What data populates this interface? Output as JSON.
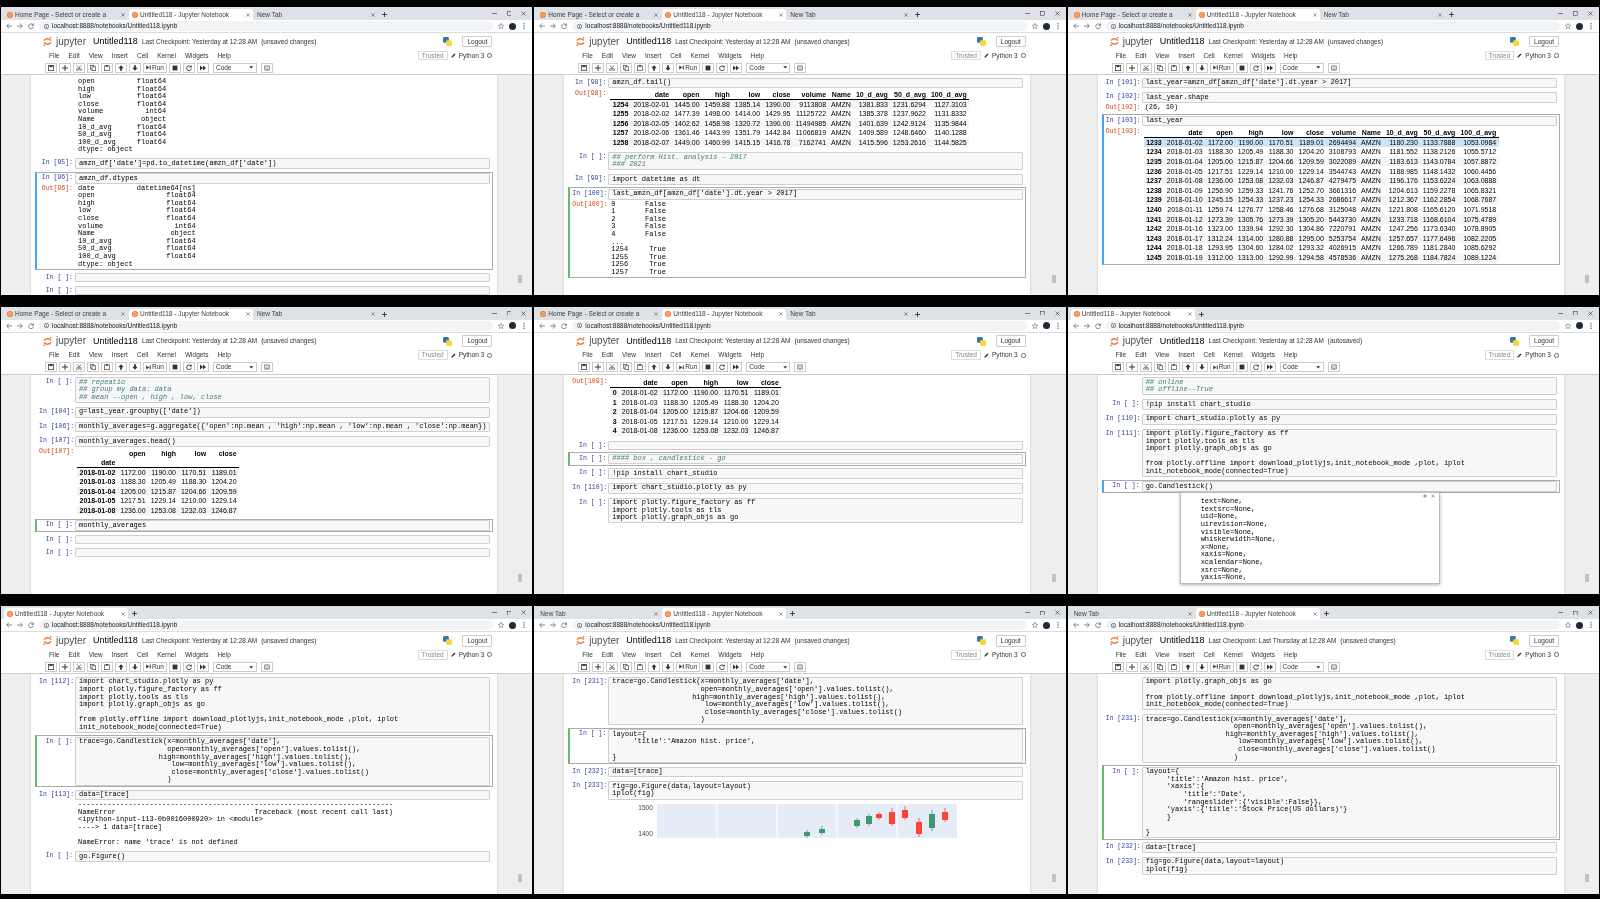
{
  "panels": [
    {
      "tabs": [
        {
          "label": "Home Page - Select or create a",
          "kind": "jupyter",
          "selected": false
        },
        {
          "label": "Untitled118 - Jupyter Notebook",
          "kind": "jupyter",
          "selected": true
        },
        {
          "label": "New Tab",
          "kind": "blank",
          "selected": false
        }
      ],
      "url": "localhost:8888/notebooks/Untitled118.ipynb",
      "app_name": "jupyter",
      "notebook_name": "Untitled118",
      "checkpoint": "Last Checkpoint: Yesterday at 12:28 AM",
      "save_status": "(unsaved changes)",
      "logout": "Logout",
      "menu": [
        "File",
        "Edit",
        "View",
        "Insert",
        "Cell",
        "Kernel",
        "Widgets",
        "Help"
      ],
      "trusted": "Trusted",
      "kernel": "Python 3",
      "run": "Run",
      "cell_type": "Code",
      "cells": [
        {
          "selected": false,
          "output": {
            "kind": "text",
            "lines": [
              [
                "open          float64",
                "high          float64",
                "low           float64",
                "close         float64",
                "volume          int64",
                "Name           object",
                "10_d_avg      float64",
                "50_d_avg      float64",
                "100_d_avg     float64",
                "dtype: object"
              ]
            ]
          }
        },
        {
          "selected": false,
          "input": {
            "prompt": "In [95]:",
            "kind": "code",
            "code": [
              [
                "amzn_df['date']=pd.to_datetime(amzn_df['date'])"
              ]
            ]
          }
        },
        {
          "selected": true,
          "edit_mode": false,
          "input": {
            "prompt": "In [96]:",
            "kind": "code",
            "code": [
              [
                "amzn_df.dtypes"
              ]
            ]
          },
          "output": {
            "prompt": "Out[96]:",
            "kind": "text",
            "lines": [
              [
                "date          datetime64[ns]",
                "open                 float64",
                "high                 float64",
                "low                  float64",
                "close                float64",
                "volume                 int64",
                "Name                  object",
                "10_d_avg             float64",
                "50_d_avg             float64",
                "100_d_avg            float64",
                "dtype: object"
              ]
            ]
          }
        },
        {
          "selected": false,
          "input": {
            "prompt": "In [ ]:",
            "kind": "code"
          }
        },
        {
          "selected": false,
          "input": {
            "prompt": "In [ ]:",
            "kind": "code"
          }
        }
      ]
    },
    {
      "tabs": [
        {
          "label": "Home Page - Select or create a",
          "kind": "jupyter",
          "selected": false
        },
        {
          "label": "Untitled118 - Jupyter Notebook",
          "kind": "jupyter",
          "selected": true
        },
        {
          "label": "New Tab",
          "kind": "blank",
          "selected": false
        }
      ],
      "url": "localhost:8888/notebooks/Untitled118.ipynb",
      "app_name": "jupyter",
      "notebook_name": "Untitled118",
      "checkpoint": "Last Checkpoint: Yesterday at 12:28 AM",
      "save_status": "(unsaved changes)",
      "logout": "Logout",
      "menu": [
        "File",
        "Edit",
        "View",
        "Insert",
        "Cell",
        "Kernel",
        "Widgets",
        "Help"
      ],
      "trusted": "Trusted",
      "kernel": "Python 3",
      "run": "Run",
      "cell_type": "Code",
      "cells": [
        {
          "selected": false,
          "input": {
            "prompt": "In [98]:",
            "kind": "code",
            "code": [
              [
                "amzn_df.tail()"
              ]
            ]
          },
          "output": {
            "prompt": "Out[98]:",
            "kind": "table",
            "columns": [
              "",
              "date",
              "open",
              "high",
              "low",
              "close",
              "volume",
              "Name",
              "10_d_avg",
              "50_d_avg",
              "100_d_avg"
            ],
            "rows": [
              [
                "1254",
                "2018-02-01",
                "1445.00",
                "1459.88",
                "1385.14",
                "1390.00",
                "9113808",
                "AMZN",
                "1381.833",
                "1231.6294",
                "1127.3103"
              ],
              [
                "1255",
                "2018-02-02",
                "1477.39",
                "1498.00",
                "1414.00",
                "1429.95",
                "11125722",
                "AMZN",
                "1385.378",
                "1237.9622",
                "1131.8332"
              ],
              [
                "1256",
                "2018-02-05",
                "1402.62",
                "1458.98",
                "1320.72",
                "1390.00",
                "11494985",
                "AMZN",
                "1401.639",
                "1242.9124",
                "1135.9844"
              ],
              [
                "1257",
                "2018-02-06",
                "1361.46",
                "1443.99",
                "1351.79",
                "1442.84",
                "11066819",
                "AMZN",
                "1409.589",
                "1248.6460",
                "1140.1288"
              ],
              [
                "1258",
                "2018-02-07",
                "1449.00",
                "1460.99",
                "1415.15",
                "1416.78",
                "7162741",
                "AMZN",
                "1415.596",
                "1253.2616",
                "1144.5825"
              ]
            ]
          }
        },
        {
          "selected": false,
          "input": {
            "prompt": "In [ ]:",
            "kind": "comment",
            "code": [
              [
                "## perform Hist. analysis - 2017",
                "### 2021"
              ]
            ]
          }
        },
        {
          "selected": false,
          "input": {
            "prompt": "In [99]:",
            "kind": "code",
            "code": [
              [
                "import datetime as dt"
              ]
            ]
          }
        },
        {
          "selected": true,
          "edit_mode": true,
          "input": {
            "prompt": "In [100]:",
            "kind": "code",
            "code": [
              [
                "last_amzn_df[amzn_df['date'].dt.year > 2017]"
              ]
            ]
          },
          "output": {
            "prompt": "Out[100]:",
            "kind": "text",
            "lines": [
              [
                "0       False",
                "1       False",
                "2       False",
                "3       False",
                "4       False",
                "...",
                "1254     True",
                "1255     True",
                "1256     True",
                "1257     True"
              ]
            ]
          }
        }
      ]
    },
    {
      "tabs": [
        {
          "label": "Home Page - Select or create a",
          "kind": "jupyter",
          "selected": false
        },
        {
          "label": "Untitled118 - Jupyter Notebook",
          "kind": "jupyter",
          "selected": true
        },
        {
          "label": "New Tab",
          "kind": "blank",
          "selected": false
        }
      ],
      "url": "localhost:8888/notebooks/Untitled118.ipynb",
      "app_name": "jupyter",
      "notebook_name": "Untitled118",
      "checkpoint": "Last Checkpoint: Yesterday at 12:28 AM",
      "save_status": "(unsaved changes)",
      "logout": "Logout",
      "menu": [
        "File",
        "Edit",
        "View",
        "Insert",
        "Cell",
        "Kernel",
        "Widgets",
        "Help"
      ],
      "trusted": "Trusted",
      "kernel": "Python 3",
      "run": "Run",
      "cell_type": "Code",
      "cells": [
        {
          "selected": false,
          "input": {
            "prompt": "In [101]:",
            "kind": "code",
            "code": [
              [
                "last_year=amzn_df[amzn_df['date'].dt.year > 2017]"
              ]
            ]
          }
        },
        {
          "selected": false,
          "input": {
            "prompt": "In [102]:",
            "kind": "code",
            "code": [
              [
                "last_year.shape"
              ]
            ]
          },
          "output": {
            "prompt": "Out[102]:",
            "kind": "text",
            "lines": [
              [
                "(26, 10)"
              ]
            ]
          }
        },
        {
          "selected": true,
          "edit_mode": false,
          "input": {
            "prompt": "In [103]:",
            "kind": "code",
            "code": [
              [
                "last_year"
              ]
            ]
          },
          "output": {
            "prompt": "Out[103]:",
            "kind": "table",
            "columns": [
              "",
              "date",
              "open",
              "high",
              "low",
              "close",
              "volume",
              "Name",
              "10_d_avg",
              "50_d_avg",
              "100_d_avg"
            ],
            "rows": [
              {
                "cells": [
                  "1233",
                  "2018-01-02",
                  "1172.00",
                  "1190.00",
                  "1170.51",
                  "1189.01",
                  "2694494",
                  "AMZN",
                  "1180.230",
                  "1133.7888",
                  "1053.0984"
                ],
                "selected": true
              },
              {
                "cells": [
                  "1234",
                  "2018-01-03",
                  "1188.30",
                  "1205.49",
                  "1188.30",
                  "1204.20",
                  "3108793",
                  "AMZN",
                  "1181.552",
                  "1138.2126",
                  "1055.5712"
                ],
                "selected": false
              },
              {
                "cells": [
                  "1235",
                  "2018-01-04",
                  "1205.00",
                  "1215.87",
                  "1204.66",
                  "1209.59",
                  "3022089",
                  "AMZN",
                  "1183.613",
                  "1143.0784",
                  "1057.8872"
                ],
                "selected": false
              },
              {
                "cells": [
                  "1236",
                  "2018-01-05",
                  "1217.51",
                  "1229.14",
                  "1210.00",
                  "1229.14",
                  "3544743",
                  "AMZN",
                  "1188.985",
                  "1148.1432",
                  "1060.4456"
                ],
                "selected": false
              },
              {
                "cells": [
                  "1237",
                  "2018-01-08",
                  "1236.00",
                  "1253.08",
                  "1232.03",
                  "1246.87",
                  "4279475",
                  "AMZN",
                  "1196.176",
                  "1153.6224",
                  "1063.0888"
                ],
                "selected": false
              },
              {
                "cells": [
                  "1238",
                  "2018-01-09",
                  "1256.90",
                  "1259.33",
                  "1241.76",
                  "1252.70",
                  "3661316",
                  "AMZN",
                  "1204.613",
                  "1159.2278",
                  "1065.8321"
                ],
                "selected": false
              },
              {
                "cells": [
                  "1239",
                  "2018-01-10",
                  "1245.15",
                  "1254.33",
                  "1237.23",
                  "1254.33",
                  "2686617",
                  "AMZN",
                  "1212.367",
                  "1162.2854",
                  "1068.7687"
                ],
                "selected": false
              },
              {
                "cells": [
                  "1240",
                  "2018-01-11",
                  "1259.74",
                  "1276.77",
                  "1258.46",
                  "1276.68",
                  "3125048",
                  "AMZN",
                  "1221.808",
                  "1165.6120",
                  "1071.9518"
                ],
                "selected": false
              },
              {
                "cells": [
                  "1241",
                  "2018-01-12",
                  "1273.39",
                  "1305.76",
                  "1273.39",
                  "1305.20",
                  "5443730",
                  "AMZN",
                  "1233.718",
                  "1168.6104",
                  "1075.4789"
                ],
                "selected": false
              },
              {
                "cells": [
                  "1242",
                  "2018-01-16",
                  "1323.00",
                  "1339.94",
                  "1292.30",
                  "1304.86",
                  "7220791",
                  "AMZN",
                  "1247.256",
                  "1173.6340",
                  "1078.8905"
                ],
                "selected": false
              },
              {
                "cells": [
                  "1243",
                  "2018-01-17",
                  "1312.24",
                  "1314.00",
                  "1280.88",
                  "1295.00",
                  "5253754",
                  "AMZN",
                  "1257.657",
                  "1177.6496",
                  "1082.2205"
                ],
                "selected": false
              },
              {
                "cells": [
                  "1244",
                  "2018-01-18",
                  "1293.95",
                  "1304.60",
                  "1284.02",
                  "1293.32",
                  "4026915",
                  "AMZN",
                  "1266.789",
                  "1181.2840",
                  "1085.6292"
                ],
                "selected": false
              },
              {
                "cells": [
                  "1245",
                  "2018-01-19",
                  "1312.00",
                  "1313.00",
                  "1292.99",
                  "1294.58",
                  "4578536",
                  "AMZN",
                  "1275.268",
                  "1184.7824",
                  "1089.1224"
                ],
                "selected": false
              }
            ]
          }
        }
      ]
    },
    {
      "tabs": [
        {
          "label": "Home Page - Select or create a",
          "kind": "jupyter",
          "selected": false
        },
        {
          "label": "Untitled118 - Jupyter Notebook",
          "kind": "jupyter",
          "selected": true
        },
        {
          "label": "New Tab",
          "kind": "blank",
          "selected": false
        }
      ],
      "url": "localhost:8888/notebooks/Untitled118.ipynb",
      "app_name": "jupyter",
      "notebook_name": "Untitled118",
      "checkpoint": "Last Checkpoint: Yesterday at 12:28 AM",
      "save_status": "(unsaved changes)",
      "logout": "Logout",
      "menu": [
        "File",
        "Edit",
        "View",
        "Insert",
        "Cell",
        "Kernel",
        "Widgets",
        "Help"
      ],
      "trusted": "Trusted",
      "kernel": "Python 3",
      "run": "Run",
      "cell_type": "Code",
      "cells": [
        {
          "selected": false,
          "input": {
            "prompt": "In [ ]:",
            "kind": "comment",
            "code": [
              [
                "## repeatio",
                "## group my data: data",
                "## mean --open , high , low, close"
              ]
            ]
          }
        },
        {
          "selected": false,
          "input": {
            "prompt": "In [104]:",
            "kind": "code",
            "code": [
              [
                "g=last_year.groupby(['date'])"
              ]
            ]
          }
        },
        {
          "selected": false,
          "input": {
            "prompt": "In [106]:",
            "kind": "code",
            "code": [
              [
                "monthly_averages=g.aggregate({'open':np.mean , 'high':np.mean , 'low':np.mean , 'close':np.mean})"
              ]
            ]
          }
        },
        {
          "selected": false,
          "input": {
            "prompt": "In [107]:",
            "kind": "code",
            "code": [
              [
                "monthly_averages.head()"
              ]
            ]
          },
          "output": {
            "prompt": "Out[107]:",
            "kind": "table",
            "columns": [
              "",
              "open",
              "high",
              "low",
              "close"
            ],
            "index_name": "date",
            "rows": [
              [
                "2018-01-02",
                "1172.00",
                "1190.00",
                "1170.51",
                "1189.01"
              ],
              [
                "2018-01-03",
                "1188.30",
                "1205.49",
                "1188.30",
                "1204.20"
              ],
              [
                "2018-01-04",
                "1205.00",
                "1215.87",
                "1204.66",
                "1209.59"
              ],
              [
                "2018-01-05",
                "1217.51",
                "1229.14",
                "1210.00",
                "1229.14"
              ],
              [
                "2018-01-08",
                "1236.00",
                "1253.08",
                "1232.03",
                "1246.87"
              ]
            ]
          }
        },
        {
          "selected": true,
          "edit_mode": true,
          "input": {
            "prompt": "In [ ]:",
            "kind": "code",
            "code": [
              [
                "monthly_averages"
              ]
            ]
          }
        },
        {
          "selected": false,
          "input": {
            "prompt": "In [ ]:",
            "kind": "code"
          }
        },
        {
          "selected": false,
          "input": {
            "prompt": "In [ ]:",
            "kind": "code"
          }
        }
      ]
    },
    {
      "tabs": [
        {
          "label": "Home Page - Select or create a",
          "kind": "jupyter",
          "selected": false
        },
        {
          "label": "Untitled118 - Jupyter Notebook",
          "kind": "jupyter",
          "selected": true
        },
        {
          "label": "New Tab",
          "kind": "blank",
          "selected": false
        }
      ],
      "url": "localhost:8888/notebooks/Untitled118.ipynb",
      "app_name": "jupyter",
      "notebook_name": "Untitled118",
      "checkpoint": "Last Checkpoint: Yesterday at 12:28 AM",
      "save_status": "(unsaved changes)",
      "logout": "Logout",
      "menu": [
        "File",
        "Edit",
        "View",
        "Insert",
        "Cell",
        "Kernel",
        "Widgets",
        "Help"
      ],
      "trusted": "Trusted",
      "kernel": "Python 3",
      "run": "Run",
      "cell_type": "Code",
      "cells": [
        {
          "selected": false,
          "output": {
            "prompt": "Out[109]:",
            "kind": "table",
            "columns": [
              "",
              "date",
              "open",
              "high",
              "low",
              "close"
            ],
            "rows": [
              [
                "0",
                "2018-01-02",
                "1172.00",
                "1190.00",
                "1170.51",
                "1189.01"
              ],
              [
                "1",
                "2018-01-03",
                "1188.30",
                "1205.49",
                "1188.30",
                "1204.20"
              ],
              [
                "2",
                "2018-01-04",
                "1205.00",
                "1215.87",
                "1204.66",
                "1209.59"
              ],
              [
                "3",
                "2018-01-05",
                "1217.51",
                "1229.14",
                "1210.00",
                "1229.14"
              ],
              [
                "4",
                "2018-01-08",
                "1236.00",
                "1253.08",
                "1232.03",
                "1246.87"
              ]
            ]
          }
        },
        {
          "selected": false,
          "input": {
            "prompt": "In [ ]:",
            "kind": "code"
          }
        },
        {
          "selected": true,
          "edit_mode": true,
          "input": {
            "prompt": "In [ ]:",
            "kind": "comment",
            "code": [
              [
                "#### box , candlestick - go"
              ]
            ]
          }
        },
        {
          "selected": false,
          "input": {
            "prompt": "In [ ]:",
            "kind": "code",
            "code": [
              [
                "!pip install chart_studio"
              ]
            ]
          }
        },
        {
          "selected": false,
          "input": {
            "prompt": "In [110]:",
            "kind": "code",
            "code": [
              [
                "import chart_studio.plotly as py"
              ]
            ]
          }
        },
        {
          "selected": false,
          "input": {
            "prompt": "In [ ]:",
            "kind": "code",
            "code": [
              [
                "import plotly.figure_factory as ff",
                "import plotly.tools as tls",
                "import plotly.graph_objs as go"
              ]
            ]
          }
        }
      ]
    },
    {
      "tabs": [
        {
          "label": "Untitled118 - Jupyter Notebook",
          "kind": "jupyter",
          "selected": true
        }
      ],
      "url": "localhost:8888/notebooks/Untitled118.ipynb",
      "app_name": "jupyter",
      "notebook_name": "Untitled118",
      "checkpoint": "Last Checkpoint: Yesterday at 12:28 AM",
      "save_status": "(autosaved)",
      "logout": "Logout",
      "menu": [
        "File",
        "Edit",
        "View",
        "Insert",
        "Cell",
        "Kernel",
        "Widgets",
        "Help"
      ],
      "trusted": "Trusted",
      "kernel": "Python 3",
      "run": "Run",
      "cell_type": "Code",
      "cells": [
        {
          "selected": false,
          "input": {
            "kind": "comment",
            "code": [
              [
                "## online",
                "## offline--True"
              ]
            ]
          }
        },
        {
          "selected": false,
          "input": {
            "prompt": "In [ ]:",
            "kind": "code",
            "code": [
              [
                "!pip install chart_studio"
              ]
            ]
          }
        },
        {
          "selected": false,
          "input": {
            "prompt": "In [110]:",
            "kind": "code",
            "code": [
              [
                "import chart_studio.plotly as py"
              ]
            ]
          }
        },
        {
          "selected": false,
          "input": {
            "prompt": "In [111]:",
            "kind": "code",
            "code": [
              [
                "import plotly.figure_factory as ff",
                "import plotly.tools as tls",
                "import plotly.graph_objs as go"
              ],
              [
                "from plotly.offline import download_plotlyjs,init_notebook_mode ,plot, iplot",
                "init_notebook_mode(connected=True)"
              ]
            ]
          }
        },
        {
          "selected": true,
          "edit_mode": false,
          "input": {
            "prompt": "In [ ]:",
            "kind": "code",
            "code": [
              [
                "go.Candlestick()"
              ]
            ]
          },
          "tooltip": {
            "lines": [
              "text=None,",
              "textsrc=None,",
              "uid=None,",
              "uirevision=None,",
              "visible=None,",
              "whiskerwidth=None,",
              "x=None,",
              "xaxis=None,",
              "xcalendar=None,",
              "xsrc=None,",
              "yaxis=None,"
            ]
          }
        }
      ]
    },
    {
      "tabs": [
        {
          "label": "Untitled118 - Jupyter Notebook",
          "kind": "jupyter",
          "selected": true
        }
      ],
      "url": "localhost:8888/notebooks/Untitled118.ipynb",
      "app_name": "jupyter",
      "notebook_name": "Untitled118",
      "checkpoint": "Last Checkpoint: Yesterday at 12:28 AM",
      "save_status": "(unsaved changes)",
      "logout": "Logout",
      "menu": [
        "File",
        "Edit",
        "View",
        "Insert",
        "Cell",
        "Kernel",
        "Widgets",
        "Help"
      ],
      "trusted": "Trusted",
      "kernel": "Python 3",
      "run": "Run",
      "cell_type": "Code",
      "cells": [
        {
          "selected": false,
          "input": {
            "prompt": "In [112]:",
            "kind": "code",
            "code": [
              [
                "import chart_studio.plotly as py",
                "import plotly.figure_factory as ff",
                "import plotly.tools as tls",
                "import plotly.graph_objs as go"
              ],
              [
                "from plotly.offline import download_plotlyjs,init_notebook_mode ,plot, iplot",
                "init_notebook_mode(connected=True)"
              ]
            ]
          }
        },
        {
          "selected": true,
          "edit_mode": true,
          "input": {
            "prompt": "In [ ]:",
            "kind": "code",
            "code": [
              [
                "trace=go.Candlestick(x=monthly_averages['date'],",
                "                     open=monthly_averages['open'].values.tolist(),",
                "                   high=monthly_averages['high'].values.tolist(),",
                "                      low=monthly_averages['low'].values.tolist(),",
                "                      close=monthly_averages['close'].values.tolist()",
                "                     )"
              ]
            ]
          }
        },
        {
          "selected": false,
          "input": {
            "prompt": "In [113]:",
            "kind": "code",
            "code": [
              [
                "data=[trace]"
              ]
            ]
          },
          "output": {
            "kind": "text",
            "lines": [
              [
                "---------------------------------------------------------------------------",
                "NameError                                 Traceback (most recent call last)",
                "<ipython-input-113-0b0016000920> in <module>",
                "----> 1 data=[trace]"
              ],
              [
                "NameError: name 'trace' is not defined"
              ]
            ]
          }
        },
        {
          "selected": false,
          "input": {
            "prompt": "In [ ]:",
            "kind": "code",
            "code": [
              [
                "go.Figure()"
              ]
            ]
          }
        }
      ]
    },
    {
      "tabs": [
        {
          "label": "New Tab",
          "kind": "blank",
          "selected": false
        },
        {
          "label": "Untitled118 - Jupyter Notebook",
          "kind": "jupyter",
          "selected": true
        }
      ],
      "url": "localhost:8888/notebooks/Untitled118.ipynb",
      "app_name": "jupyter",
      "notebook_name": "Untitled118",
      "checkpoint": "Last Checkpoint: Yesterday at 12:28 AM",
      "save_status": "(unsaved changes)",
      "logout": "Logout",
      "menu": [
        "File",
        "Edit",
        "View",
        "Insert",
        "Cell",
        "Kernel",
        "Widgets",
        "Help"
      ],
      "trusted": "Trusted",
      "kernel": "Python 3",
      "run": "Run",
      "cell_type": "Code",
      "cells": [
        {
          "selected": false,
          "input": {
            "prompt": "In [231]:",
            "kind": "code",
            "code": [
              [
                "trace=go.Candlestick(x=monthly_averages['date'],",
                "                     open=monthly_averages['open'].values.tolist(),",
                "                   high=monthly_averages['high'].values.tolist(),",
                "                      low=monthly_averages['low'].values.tolist(),",
                "                      close=monthly_averages['close'].values.tolist()",
                "                     )"
              ]
            ]
          }
        },
        {
          "selected": true,
          "edit_mode": true,
          "input": {
            "prompt": "In [ ]:",
            "kind": "code",
            "code": [
              [
                "layout={",
                "     'title':'Amazon hist. price',"
              ],
              [
                "}"
              ]
            ]
          }
        },
        {
          "selected": false,
          "input": {
            "prompt": "In [232]:",
            "kind": "code",
            "code": [
              [
                "data=[trace]"
              ]
            ]
          }
        },
        {
          "selected": false,
          "input": {
            "prompt": "In [233]:",
            "kind": "code",
            "code": [
              [
                "fig=go.Figure(data,layout=layout)",
                "iplot(fig)"
              ]
            ]
          },
          "output": {
            "kind": "chart",
            "y_tick_labels": [
              "1500",
              "1400"
            ]
          }
        }
      ]
    },
    {
      "tabs": [
        {
          "label": "New Tab",
          "kind": "blank",
          "selected": false
        },
        {
          "label": "Untitled118 - Jupyter Notebook",
          "kind": "jupyter",
          "selected": true
        }
      ],
      "url": "localhost:8888/notebooks/Untitled118.ipynb",
      "app_name": "jupyter",
      "notebook_name": "Untitled118",
      "checkpoint": "Last Checkpoint: Last Thursday at 12:28 AM",
      "save_status": "(unsaved changes)",
      "logout": "Logout",
      "menu": [
        "File",
        "Edit",
        "View",
        "Insert",
        "Cell",
        "Kernel",
        "Widgets",
        "Help"
      ],
      "trusted": "Trusted",
      "kernel": "Python 3",
      "run": "Run",
      "cell_type": "Code",
      "cells": [
        {
          "selected": false,
          "input": {
            "kind": "code",
            "code": [
              [
                "import plotly.graph_objs as go"
              ],
              [
                "from plotly.offline import download_plotlyjs,init_notebook_mode ,plot, iplot",
                "init_notebook_mode(connected=True)"
              ]
            ]
          }
        },
        {
          "selected": false,
          "input": {
            "prompt": "In [231]:",
            "kind": "code",
            "code": [
              [
                "trace=go.Candlestick(x=monthly_averages['date'],",
                "                     open=monthly_averages['open'].values.tolist(),",
                "                   high=monthly_averages['high'].values.tolist(),",
                "                      low=monthly_averages['low'].values.tolist(),",
                "                      close=monthly_averages['close'].values.tolist()",
                "                     )"
              ]
            ]
          }
        },
        {
          "selected": true,
          "edit_mode": true,
          "input": {
            "prompt": "In [ ]:",
            "kind": "code",
            "code": [
              [
                "layout={",
                "     'title':'Amazon hist. price',",
                "     'xaxis':{",
                "         'title':'Date',",
                "         'rangeslider':{'visible':False}},",
                "     'yaxis':{'title':'Stock Price(US dollars)'}",
                "     }"
              ],
              [
                "}"
              ]
            ]
          }
        },
        {
          "selected": false,
          "input": {
            "prompt": "In [232]:",
            "kind": "code",
            "code": [
              [
                "data=[trace]"
              ]
            ]
          }
        },
        {
          "selected": false,
          "input": {
            "prompt": "In [233]:",
            "kind": "code",
            "code": [
              [
                "fig=go.Figure(data,layout=layout)",
                "iplot(fig)"
              ]
            ]
          }
        }
      ]
    }
  ]
}
